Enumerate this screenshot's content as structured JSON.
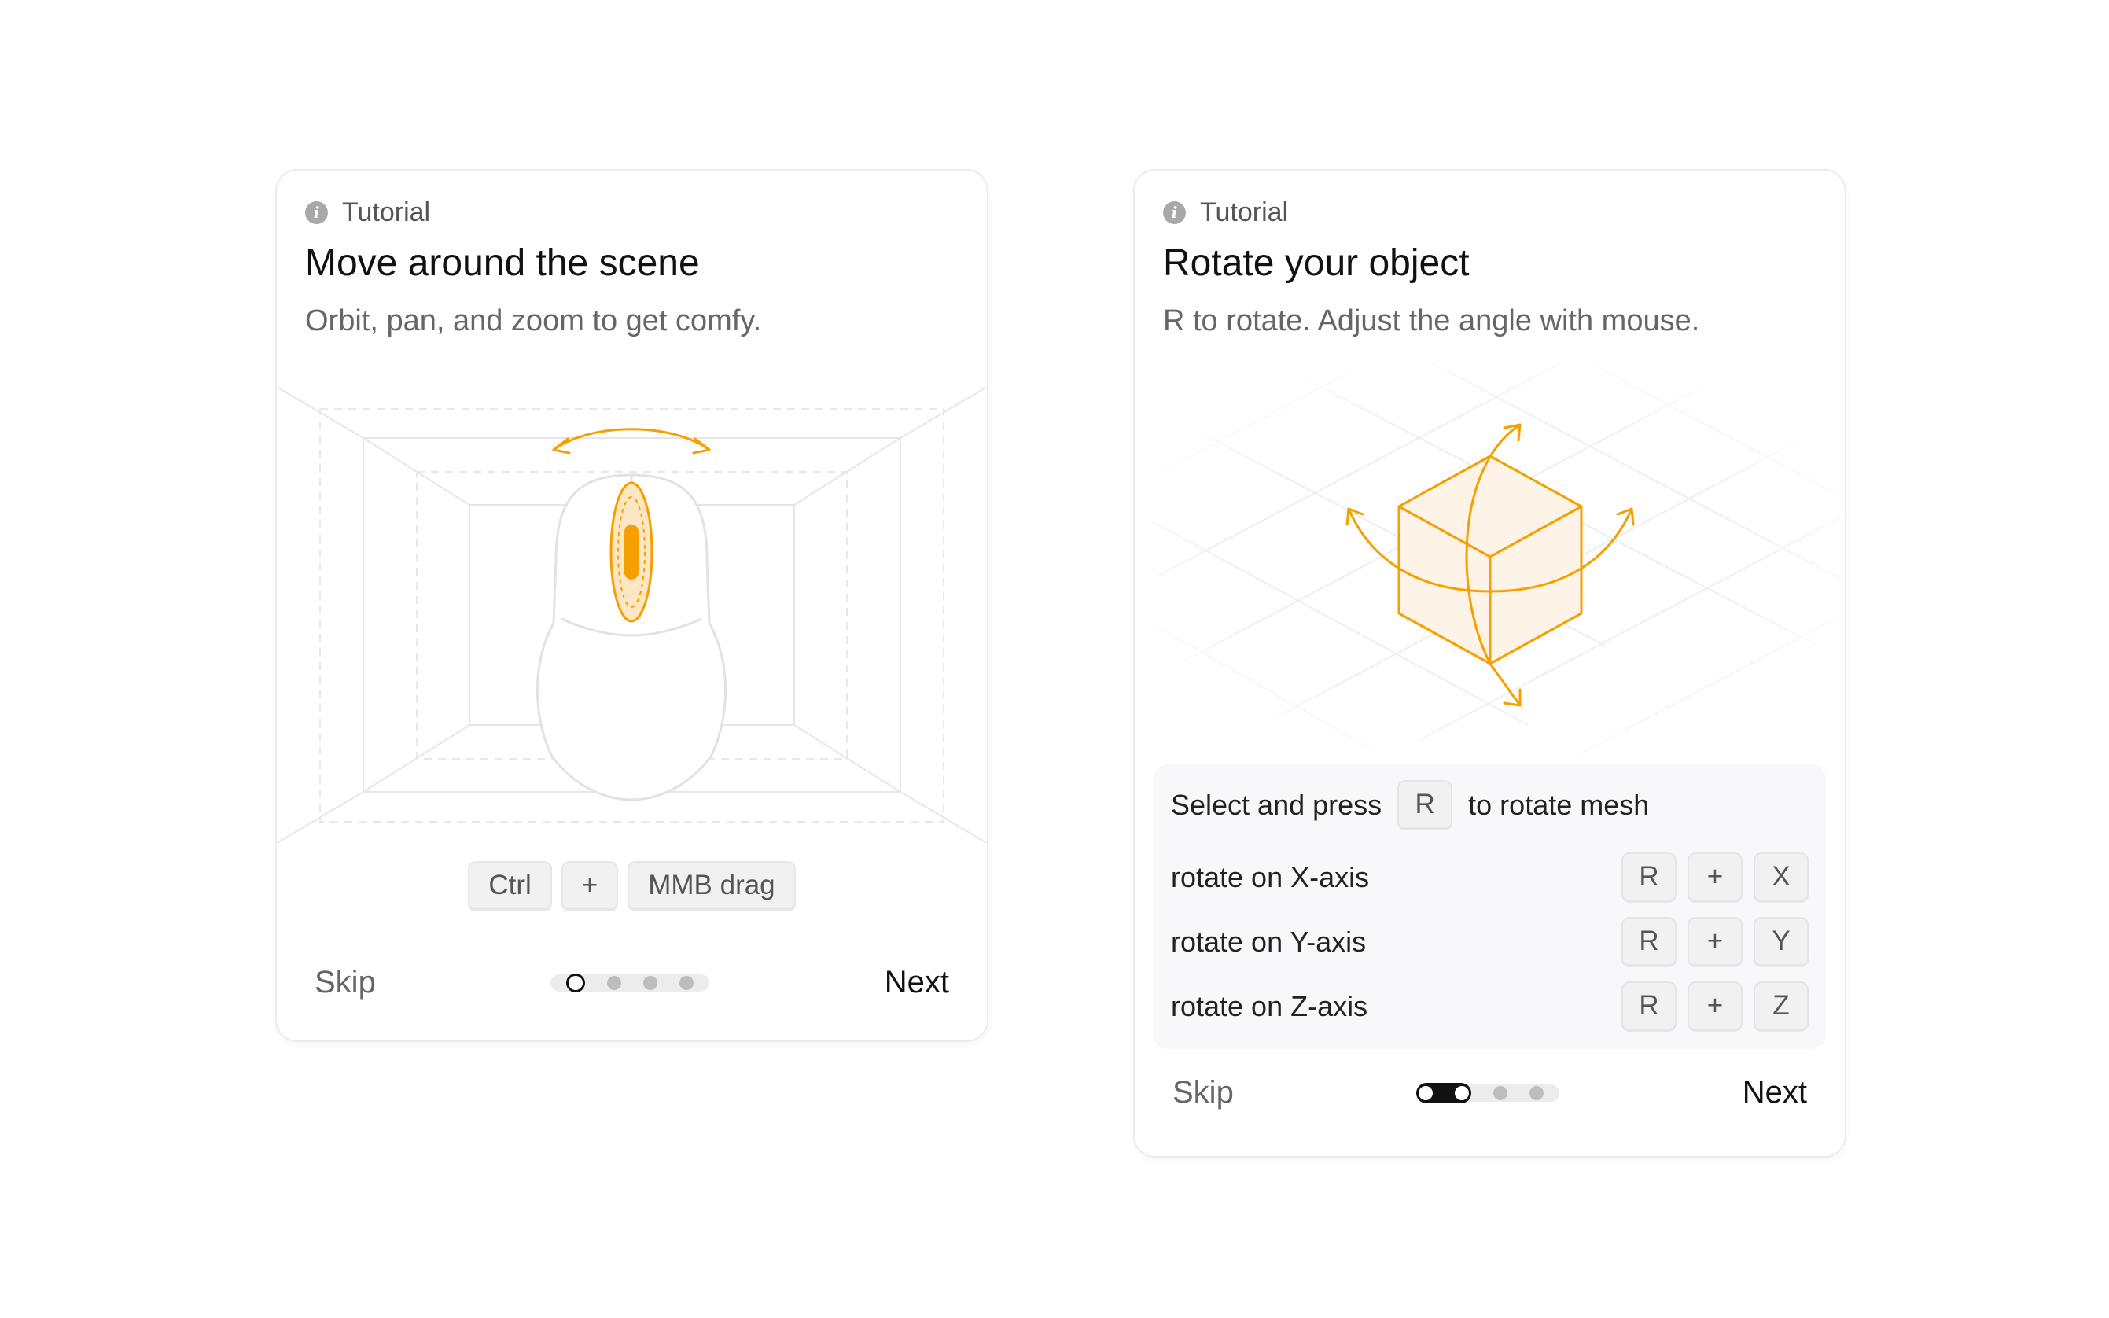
{
  "card1": {
    "tag": "Tutorial",
    "title": "Move around the scene",
    "subtitle": "Orbit, pan, and zoom to get comfy.",
    "keys": [
      "Ctrl",
      "+",
      "MMB drag"
    ],
    "skip": "Skip",
    "next": "Next",
    "step": 1,
    "total_steps": 4
  },
  "card2": {
    "tag": "Tutorial",
    "title": "Rotate your object",
    "subtitle": "R to rotate. Adjust the angle with mouse.",
    "shortcut_intro": {
      "before": "Select and press",
      "key": "R",
      "after": "to rotate mesh"
    },
    "shortcuts": [
      {
        "label": "rotate on X-axis",
        "keys": [
          "R",
          "+",
          "X"
        ]
      },
      {
        "label": "rotate on Y-axis",
        "keys": [
          "R",
          "+",
          "Y"
        ]
      },
      {
        "label": "rotate on Z-axis",
        "keys": [
          "R",
          "+",
          "Z"
        ]
      }
    ],
    "skip": "Skip",
    "next": "Next",
    "step": 2,
    "total_steps": 4
  },
  "colors": {
    "accent": "#f5a000",
    "accent_fill": "#fdf3e6",
    "line": "#e4e4e4"
  },
  "icons": {
    "info": "info-icon",
    "mouse": "mouse-icon",
    "cube": "cube-icon"
  }
}
